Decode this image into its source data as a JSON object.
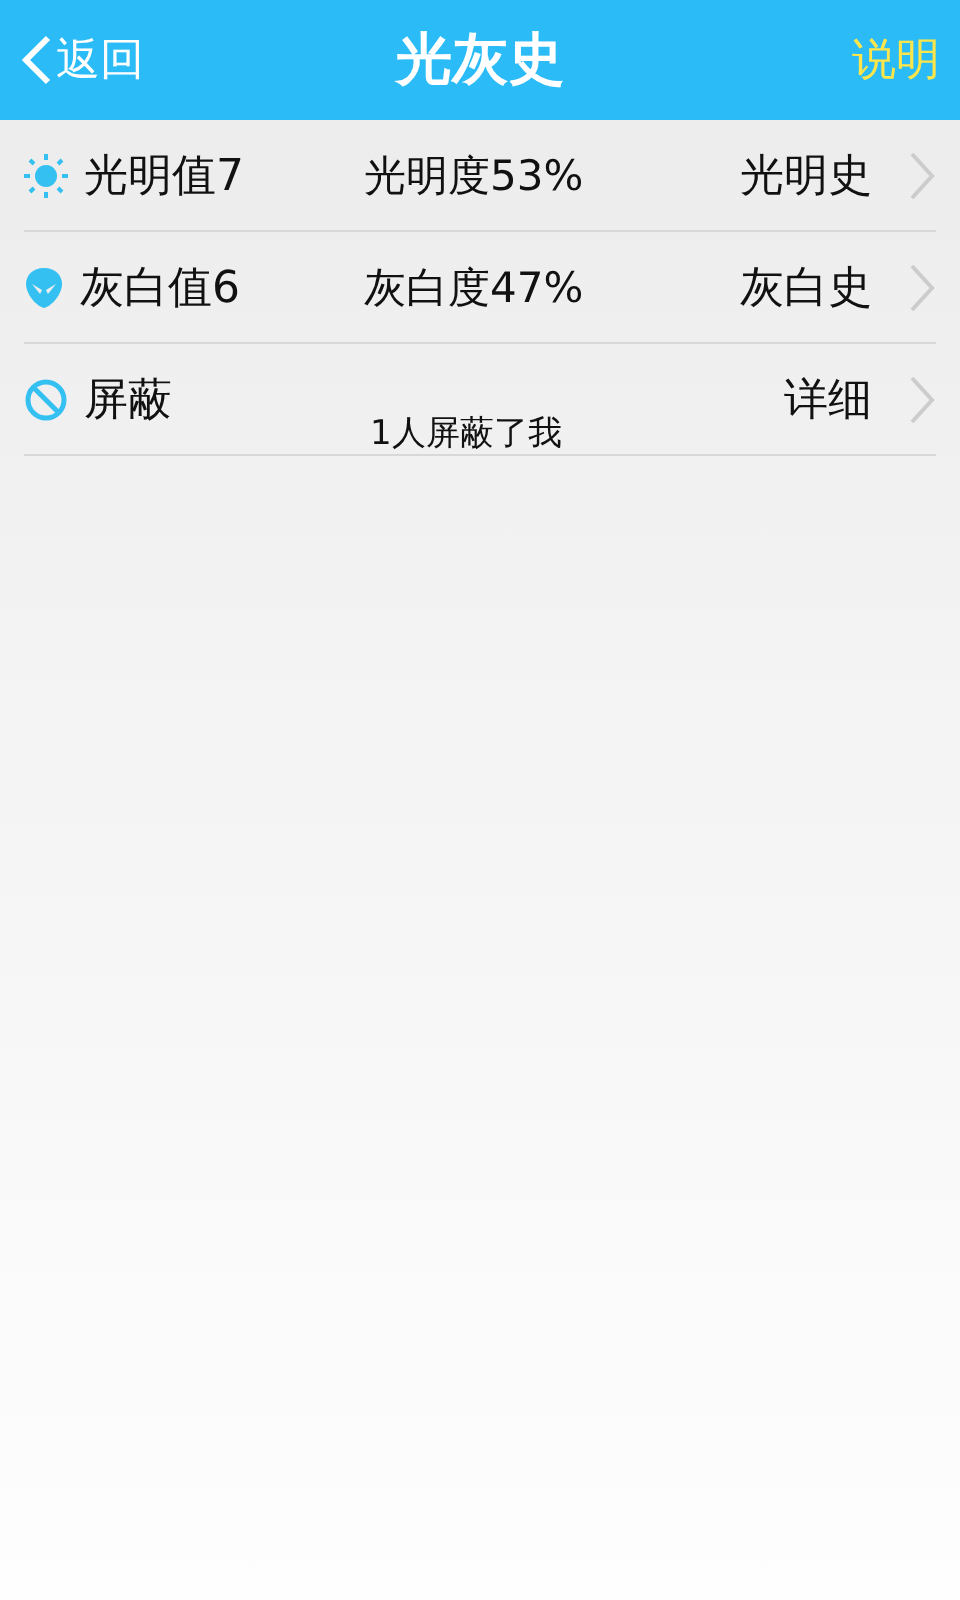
{
  "header": {
    "back": "返回",
    "title": "光灰史",
    "help": "说明"
  },
  "rows": [
    {
      "kind": "sun",
      "label": "光明值7",
      "middle": "光明度53%",
      "action": "光明史"
    },
    {
      "kind": "alien",
      "label": "灰白值6",
      "middle": "灰白度47%",
      "action": "灰白史"
    },
    {
      "kind": "block",
      "label": "屏蔽",
      "note": "1人屏蔽了我",
      "action": "详细"
    }
  ]
}
